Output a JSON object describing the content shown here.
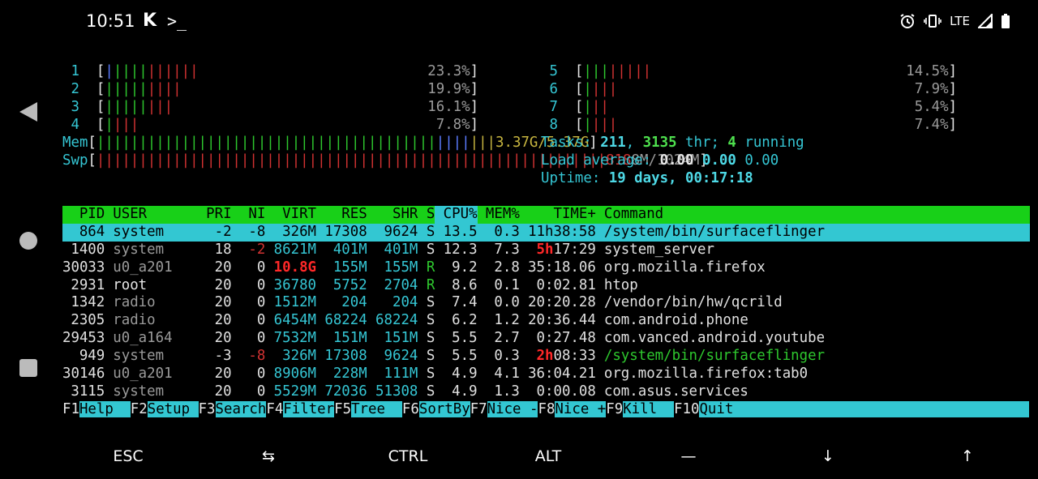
{
  "statusbar": {
    "time": "10:51",
    "app_icon": "K",
    "terminal_icon": ">_",
    "network": "LTE"
  },
  "cpus": [
    {
      "id": "1",
      "bar": [
        {
          "t": "|",
          "c": "c-blue"
        },
        {
          "t": "||||",
          "c": "c-green"
        },
        {
          "t": "||||||",
          "c": "c-red"
        }
      ],
      "pct": "23.3%"
    },
    {
      "id": "2",
      "bar": [
        {
          "t": "|||||",
          "c": "c-green"
        },
        {
          "t": "||||",
          "c": "c-red"
        }
      ],
      "pct": "19.9%"
    },
    {
      "id": "3",
      "bar": [
        {
          "t": "|||||",
          "c": "c-green"
        },
        {
          "t": "|||",
          "c": "c-red"
        }
      ],
      "pct": "16.1%"
    },
    {
      "id": "4",
      "bar": [
        {
          "t": "|",
          "c": "c-green"
        },
        {
          "t": "|||",
          "c": "c-red"
        }
      ],
      "pct": "7.8%"
    },
    {
      "id": "5",
      "bar": [
        {
          "t": "|||",
          "c": "c-green"
        },
        {
          "t": "|||||",
          "c": "c-red"
        }
      ],
      "pct": "14.5%"
    },
    {
      "id": "6",
      "bar": [
        {
          "t": "|",
          "c": "c-green"
        },
        {
          "t": "|||",
          "c": "c-red"
        }
      ],
      "pct": "7.9%"
    },
    {
      "id": "7",
      "bar": [
        {
          "t": "|",
          "c": "c-green"
        },
        {
          "t": "||",
          "c": "c-red"
        }
      ],
      "pct": "5.4%"
    },
    {
      "id": "8",
      "bar": [
        {
          "t": "|",
          "c": "c-green"
        },
        {
          "t": "|||",
          "c": "c-red"
        }
      ],
      "pct": "7.4%"
    }
  ],
  "mem": {
    "label": "Mem",
    "bar_green": "||||||||||||||||||||||||||||||||||||||||",
    "bar_blue": "||||",
    "bar_yellow": "|||",
    "value": "3.37G/5.37G"
  },
  "swp": {
    "label": "Swp",
    "bar_red": "||||||||||||||||||||||||||||||||||||||||||||||||||||||||||||",
    "value_red": "818",
    "value": "8M/1024M"
  },
  "tasks": {
    "label": "Tasks: ",
    "count": "211",
    "sep": ", ",
    "threads": "3135",
    "thr": " thr; ",
    "running": "4",
    "running_label": " running"
  },
  "load": {
    "label": "Load average: ",
    "l1": "0.00",
    "l5": "0.00",
    "l15": "0.00"
  },
  "uptime": {
    "label": "Uptime: ",
    "value": "19 days, 00:17:18"
  },
  "header": [
    "PID",
    "USER",
    "PRI",
    "NI",
    "VIRT",
    "RES",
    "SHR",
    "S",
    "CPU%",
    "MEM%",
    "TIME+",
    "Command"
  ],
  "processes": [
    {
      "pid": "864",
      "user": "system",
      "pri": "-2",
      "ni": "-8",
      "virt": "326M",
      "res": "17308",
      "shr": "9624",
      "s": "S",
      "cpu": "13.5",
      "mem": "0.3",
      "time": "11h38:58",
      "cmd": "/system/bin/surfaceflinger",
      "selected": true
    },
    {
      "pid": "1400",
      "user": "system",
      "pri": "18",
      "ni": "-2",
      "virt": "8621M",
      "res": "401M",
      "shr": "401M",
      "s": "S",
      "cpu": "12.3",
      "mem": "7.3",
      "time_hi": "5h",
      "time": "17:29",
      "cmd": "system_server"
    },
    {
      "pid": "30033",
      "user": "u0_a201",
      "pri": "20",
      "ni": "0",
      "virt": "10.8G",
      "res": "155M",
      "shr": "155M",
      "s": "R",
      "cpu": "9.2",
      "mem": "2.8",
      "time": "35:18.06",
      "cmd": "org.mozilla.firefox"
    },
    {
      "pid": "2931",
      "user": "root",
      "pri": "20",
      "ni": "0",
      "virt": "36780",
      "res": "5752",
      "shr": "2704",
      "s": "R",
      "cpu": "8.6",
      "mem": "0.1",
      "time": "0:02.81",
      "cmd": "htop"
    },
    {
      "pid": "1342",
      "user": "radio",
      "pri": "20",
      "ni": "0",
      "virt": "1512M",
      "res": "204",
      "shr": "204",
      "s": "S",
      "cpu": "7.4",
      "mem": "0.0",
      "time": "20:20.28",
      "cmd": "/vendor/bin/hw/qcrild"
    },
    {
      "pid": "2305",
      "user": "radio",
      "pri": "20",
      "ni": "0",
      "virt": "6454M",
      "res": "68224",
      "shr": "68224",
      "s": "S",
      "cpu": "6.2",
      "mem": "1.2",
      "time": "20:36.44",
      "cmd": "com.android.phone"
    },
    {
      "pid": "29453",
      "user": "u0_a164",
      "pri": "20",
      "ni": "0",
      "virt": "7532M",
      "res": "151M",
      "shr": "151M",
      "s": "S",
      "cpu": "5.5",
      "mem": "2.7",
      "time": "0:27.48",
      "cmd": "com.vanced.android.youtube"
    },
    {
      "pid": "949",
      "user": "system",
      "pri": "-3",
      "ni": "-8",
      "virt": "326M",
      "res": "17308",
      "shr": "9624",
      "s": "S",
      "cpu": "5.5",
      "mem": "0.3",
      "time_hi": "2h",
      "time": "08:33",
      "cmd": "/system/bin/surfaceflinger",
      "cmd_green": true
    },
    {
      "pid": "30146",
      "user": "u0_a201",
      "pri": "20",
      "ni": "0",
      "virt": "8906M",
      "res": "228M",
      "shr": "111M",
      "s": "S",
      "cpu": "4.9",
      "mem": "4.1",
      "time": "36:04.21",
      "cmd": "org.mozilla.firefox:tab0"
    },
    {
      "pid": "3115",
      "user": "system",
      "pri": "20",
      "ni": "0",
      "virt": "5529M",
      "res": "72036",
      "shr": "51308",
      "s": "S",
      "cpu": "4.9",
      "mem": "1.3",
      "time": "0:00.08",
      "cmd": "com.asus.services"
    }
  ],
  "fkeys": [
    {
      "key": "F1",
      "label": "Help  "
    },
    {
      "key": "F2",
      "label": "Setup "
    },
    {
      "key": "F3",
      "label": "Search"
    },
    {
      "key": "F4",
      "label": "Filter"
    },
    {
      "key": "F5",
      "label": "Tree  "
    },
    {
      "key": "F6",
      "label": "SortBy"
    },
    {
      "key": "F7",
      "label": "Nice -"
    },
    {
      "key": "F8",
      "label": "Nice +"
    },
    {
      "key": "F9",
      "label": "Kill  "
    },
    {
      "key": "F10",
      "label": "Quit"
    }
  ],
  "extrakeys": [
    "ESC",
    "⇆",
    "CTRL",
    "ALT",
    "—",
    "↓",
    "↑"
  ]
}
